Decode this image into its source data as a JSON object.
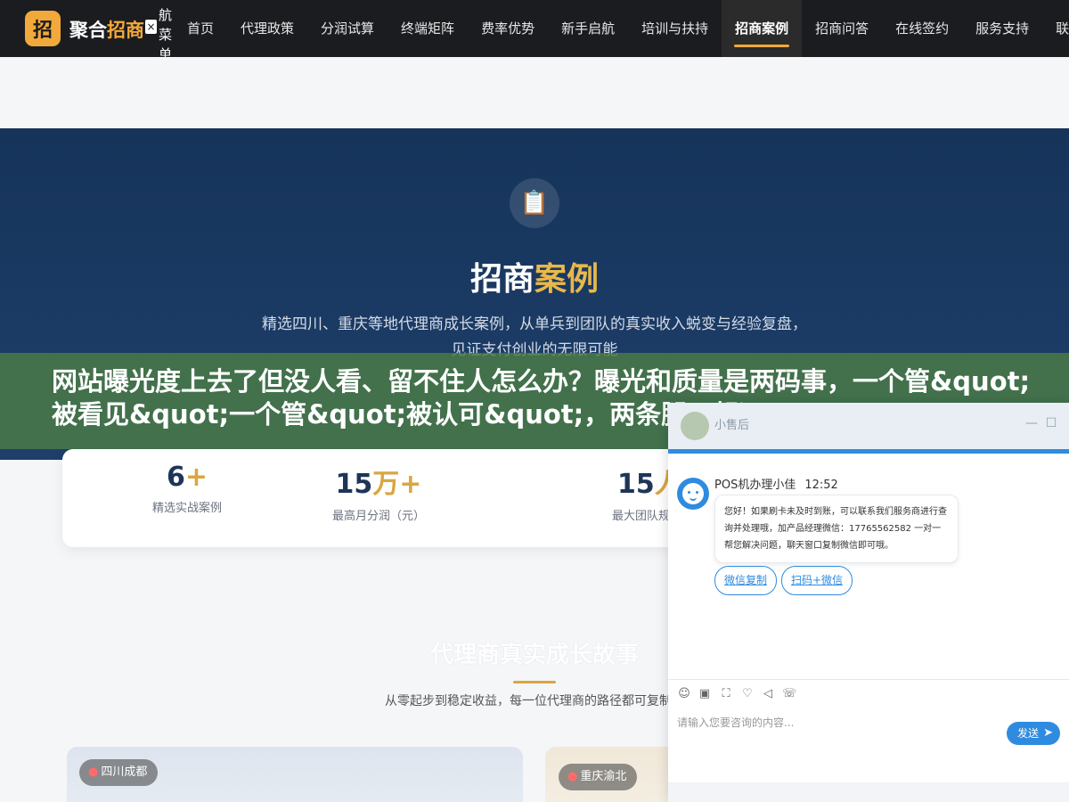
{
  "nav": {
    "logo_char": "招",
    "brand_pre": "聚合",
    "brand_hl": "招商",
    "close_glyph": "×",
    "menu_label": "航菜单",
    "items": [
      {
        "label": "首页"
      },
      {
        "label": "代理政策"
      },
      {
        "label": "分润试算"
      },
      {
        "label": "终端矩阵"
      },
      {
        "label": "费率优势"
      },
      {
        "label": "新手启航"
      },
      {
        "label": "培训与扶持"
      },
      {
        "label": "招商案例"
      },
      {
        "label": "招商问答"
      },
      {
        "label": "在线签约"
      },
      {
        "label": "服务支持"
      },
      {
        "label": "联系"
      }
    ],
    "active_index": 7
  },
  "hero": {
    "icon_glyph": "📋",
    "title_a": "招商",
    "title_b": "案例",
    "desc_line1": "精选四川、重庆等地代理商成长案例，从单兵到团队的真实收入蜕变与经验复盘，",
    "desc_line2": "见证支付创业的无限可能"
  },
  "banner": {
    "text": "网站曝光度上去了但没人看、留不住人怎么办？曝光和质量是两码事，一个管&quot;被看见&quot;一个管&quot;被认可&quot;，两条腿一起迈"
  },
  "stats": [
    {
      "value": "6",
      "unit": "+",
      "label": "精选实战案例"
    },
    {
      "value": "15",
      "unit": "万+",
      "label": "最高月分润（元）"
    },
    {
      "value": "15",
      "unit": "人",
      "label": "最大团队规"
    }
  ],
  "story": {
    "title": "代理商真实成长故事",
    "desc": "从零起步到稳定收益，每一位代理商的路径都可复制、"
  },
  "cards": [
    {
      "location": "四川成都"
    },
    {
      "location": "重庆渝北"
    }
  ],
  "chat": {
    "head_name": "小售后",
    "minimize_glyph": "—",
    "maximize_glyph": "☐",
    "agent_name": "POS机办理小佳",
    "time": "12:52",
    "message": "您好！如果刷卡未及时到账，可以联系我们服务商进行查询并处理哦，加产品经理微信：17765562582 一对一帮您解决问题，聊天窗口复制微信即可哦。",
    "quick_buttons": [
      {
        "label": "微信复制"
      },
      {
        "label": "扫码+微信"
      }
    ],
    "tools": [
      "☺",
      "▣",
      "⛶",
      "♡",
      "◁",
      "☏"
    ],
    "input_placeholder": "请输入您要咨询的内容...",
    "send_label": "发送",
    "send_arrow": "➤"
  },
  "colors": {
    "nav_bg": "#1b1c20",
    "accent_gold": "#f2a93b",
    "hero_blue": "#1e3f6b",
    "chat_blue": "#2f8be0",
    "banner_green": "#4b7d46"
  }
}
